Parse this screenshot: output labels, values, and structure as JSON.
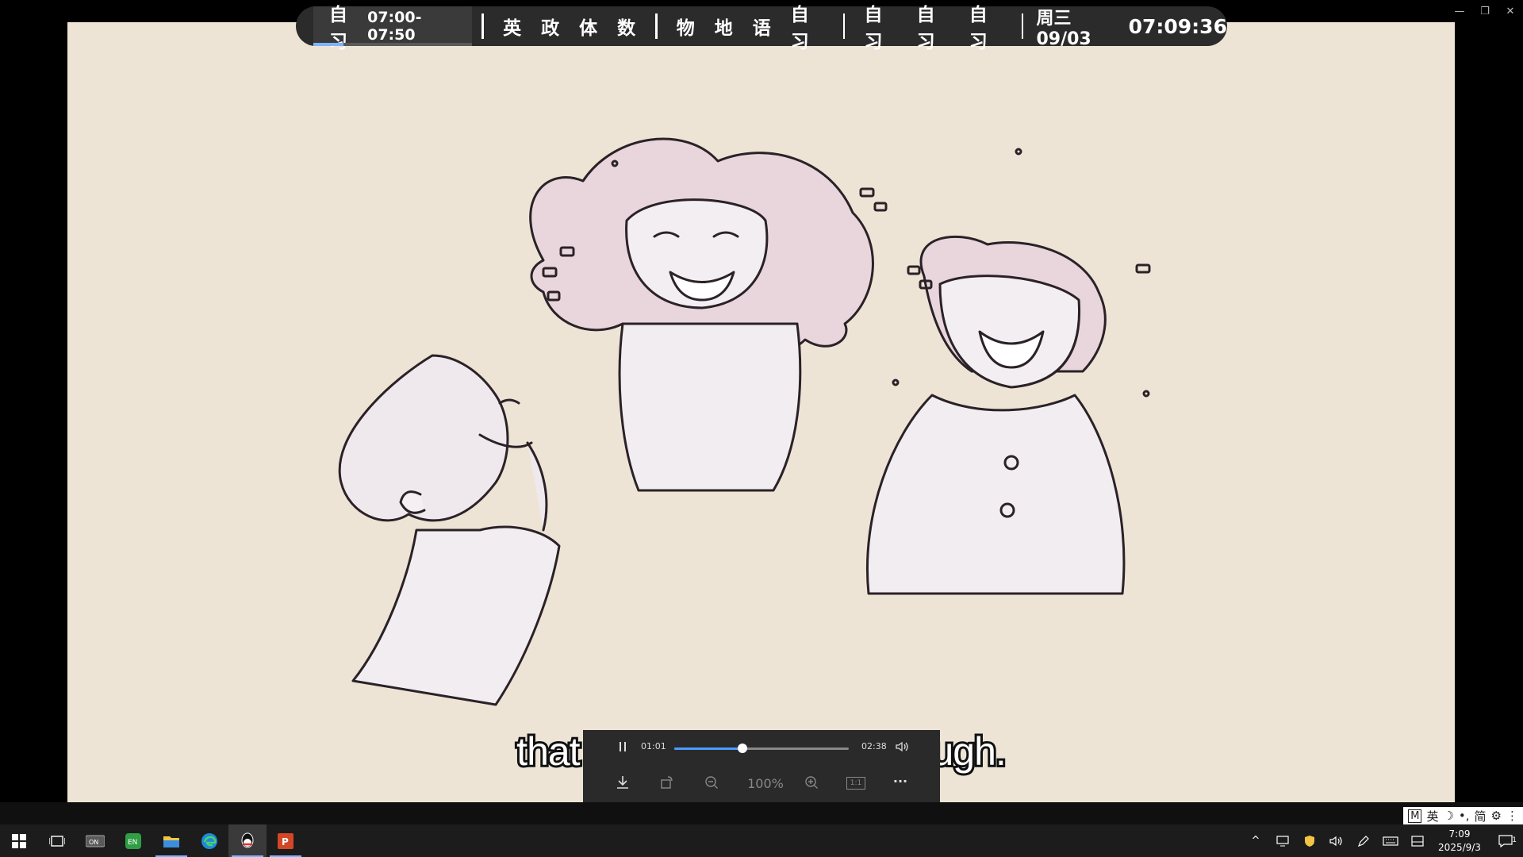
{
  "window_controls": {
    "minimize": "—",
    "restore": "❐",
    "close": "✕"
  },
  "schedule": {
    "current": {
      "label": "自习",
      "time": "07:00-07:50",
      "progress": 0.19
    },
    "groups": [
      [
        "英",
        "政",
        "体",
        "数"
      ],
      [
        "物",
        "地",
        "语",
        "自习"
      ],
      [
        "自习",
        "自习",
        "自习"
      ]
    ],
    "date": "周三 09/03",
    "clock": "07:09:36"
  },
  "subtitle": {
    "left": "that is",
    "right": "laugh."
  },
  "player": {
    "elapsed": "01:01",
    "duration": "02:38",
    "progress": 0.39,
    "zoom": "100%",
    "ratio_label": "1:1",
    "more_label": "···"
  },
  "ime": {
    "mode": "M",
    "lang": "英",
    "simplified": "简"
  },
  "taskbar": {
    "apps": [
      "start-icon",
      "task-view-icon",
      "onenote-icon",
      "en-app-icon",
      "file-explorer-icon",
      "edge-icon",
      "qq-icon",
      "powerpoint-icon"
    ],
    "clock_time": "7:09",
    "clock_date": "2025/9/3",
    "notification_count": "1"
  },
  "colors": {
    "accent": "#4a9dff",
    "paper": "#ede4d6",
    "bar": "#2b2b2b"
  }
}
